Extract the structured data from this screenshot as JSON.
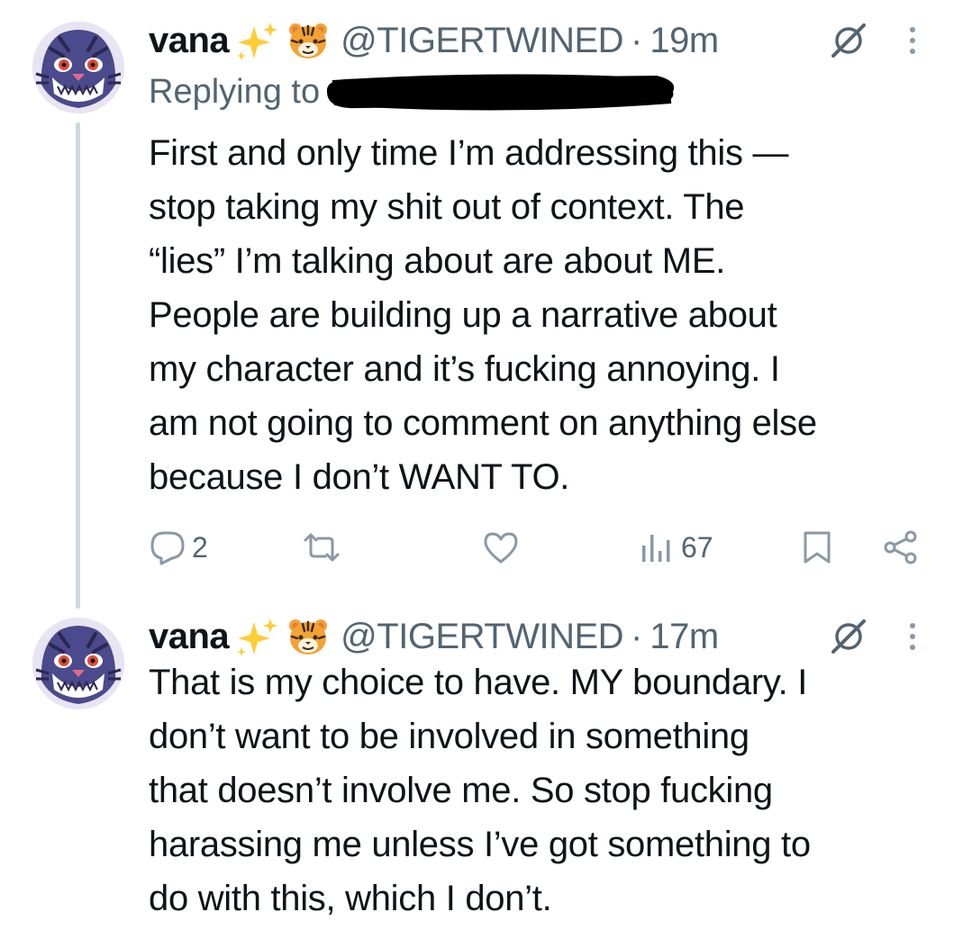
{
  "tweets": [
    {
      "name": "vana",
      "emojis": [
        "sparkles-icon",
        "tiger-face-icon"
      ],
      "handle": "@TIGERTWINED",
      "separator": "·",
      "time": "19m",
      "replying_label": "Replying to",
      "body": "First and only time I’m addressing this —\nstop taking my shit out of context. The\n“lies” I’m talking about are about ME.\nPeople are building up a narrative about\nmy character and it’s fucking annoying. I\nam not going to comment on anything else\nbecause I don’t WANT TO.",
      "actions": {
        "reply_count": "2",
        "views_count": "67"
      }
    },
    {
      "name": "vana",
      "emojis": [
        "sparkles-icon",
        "tiger-face-icon"
      ],
      "handle": "@TIGERTWINED",
      "separator": "·",
      "time": "17m",
      "body": "That is my choice to have. MY boundary. I\ndon’t want to be involved in something\nthat doesn’t involve me. So stop fucking\nharassing me unless I’ve got something to\ndo with this, which I don’t."
    }
  ],
  "colors": {
    "text_primary": "#0f1419",
    "text_secondary": "#536471",
    "thread_line": "#cfd9de",
    "icon_gray": "#8b98a5"
  }
}
